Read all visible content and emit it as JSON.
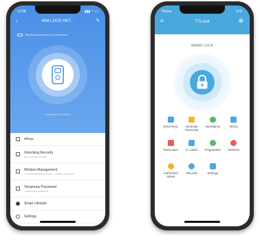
{
  "left_phone": {
    "status_time": "12:58",
    "status_icons": "▮▮▮ ◠ ▭",
    "title": "WM LOCK HKT...",
    "info_text": "Bluetooth connected to LockName",
    "hint": "Long press to unlock",
    "menu": [
      {
        "icon": "tools-icon",
        "label": "eKeys",
        "sub": ""
      },
      {
        "icon": "records-icon",
        "label": "Unlocking Records",
        "sub": "lap to unlock records"
      },
      {
        "icon": "mode-icon",
        "label": "Window Management",
        "sub": "2 modes Residence mode / 2 Mode information"
      },
      {
        "icon": "password-icon",
        "label": "Temporary Password",
        "sub": "Limited-time password"
      },
      {
        "icon": "toggle-icon",
        "label": "Smart Lifestyle",
        "sub": ""
      },
      {
        "icon": "gear-icon",
        "label": "Settings",
        "sub": ""
      }
    ]
  },
  "right_phone": {
    "status_left": "Phone",
    "status_time": "9:41",
    "title": "TTLock",
    "lock_name": "SMART LOCK",
    "grid": [
      {
        "label": "Send eKey",
        "icon_color": "#4aa9de"
      },
      {
        "label": "Generate Passcode",
        "icon_color": "#f2b431"
      },
      {
        "label": "Attendance",
        "icon_color": "#58b86a"
      },
      {
        "label": "eKeys",
        "icon_color": "#4aa9de"
      },
      {
        "label": "Passcodes",
        "icon_color": "#e85c5c"
      },
      {
        "label": "IC Cards",
        "icon_color": "#4aa9de"
      },
      {
        "label": "Fingerprints",
        "icon_color": "#58b86a"
      },
      {
        "label": "Wireless",
        "icon_color": "#e85c5c"
      },
      {
        "label": "Authorized Admin",
        "icon_color": "#f2b431"
      },
      {
        "label": "Records",
        "icon_color": "#4aa9de"
      },
      {
        "label": "Settings",
        "icon_color": "#4aa9de"
      }
    ]
  }
}
